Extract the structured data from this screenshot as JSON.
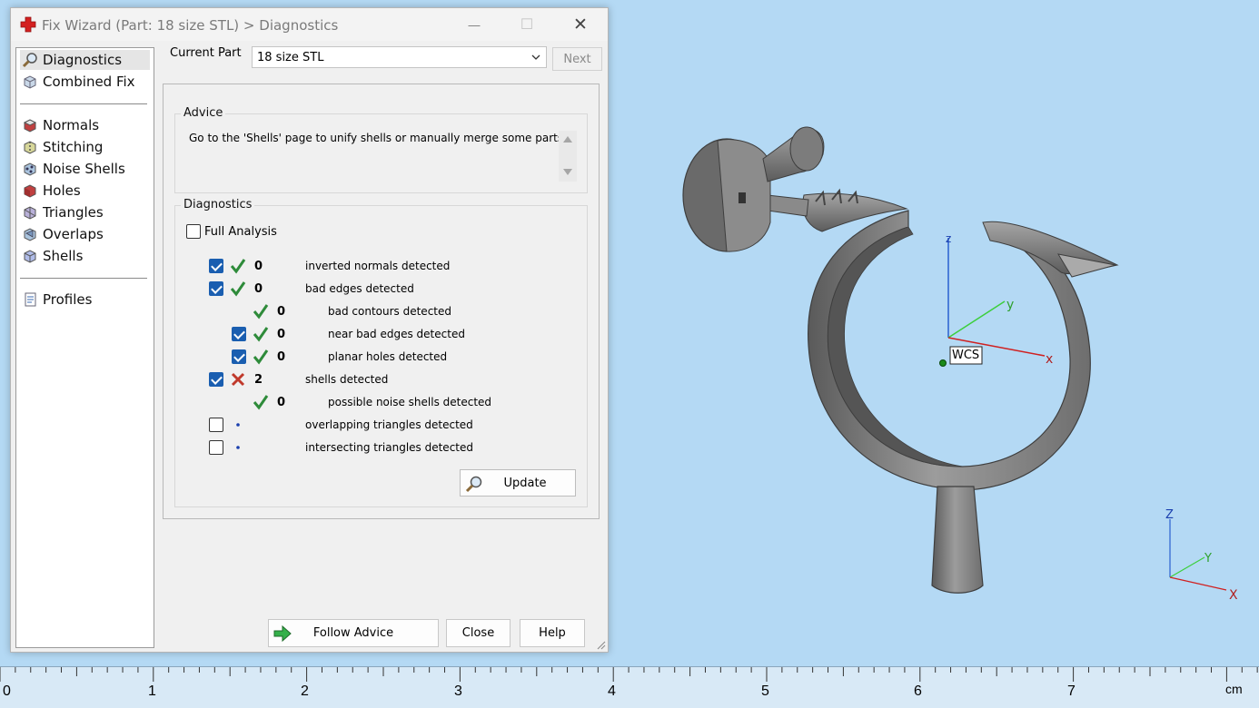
{
  "window": {
    "title": "Fix Wizard (Part: 18 size STL) > Diagnostics",
    "minimize": "—",
    "maximize": "☐",
    "close": "✕"
  },
  "nav": {
    "items": [
      {
        "label": "Diagnostics",
        "icon": "magnifier-icon",
        "selected": true
      },
      {
        "label": "Combined Fix",
        "icon": "combined-fix-icon"
      },
      {
        "label": "Normals",
        "icon": "normals-icon"
      },
      {
        "label": "Stitching",
        "icon": "stitching-icon"
      },
      {
        "label": "Noise Shells",
        "icon": "noise-shells-icon"
      },
      {
        "label": "Holes",
        "icon": "holes-icon"
      },
      {
        "label": "Triangles",
        "icon": "triangles-icon"
      },
      {
        "label": "Overlaps",
        "icon": "overlaps-icon"
      },
      {
        "label": "Shells",
        "icon": "shells-icon"
      },
      {
        "label": "Profiles",
        "icon": "profiles-icon"
      }
    ]
  },
  "current_part": {
    "label": "Current Part",
    "value": "18 size STL",
    "next_label": "Next"
  },
  "advice": {
    "title": "Advice",
    "text": "Go to the 'Shells' page to unify shells or manually merge some parts."
  },
  "diagnostics": {
    "title": "Diagnostics",
    "full_analysis": "Full Analysis",
    "rows": [
      {
        "checked": true,
        "status": "ok",
        "count": "0",
        "label": "inverted normals detected",
        "indent": 0
      },
      {
        "checked": true,
        "status": "ok",
        "count": "0",
        "label": "bad edges detected",
        "indent": 0
      },
      {
        "checked": null,
        "status": "ok",
        "count": "0",
        "label": "bad contours detected",
        "indent": 1
      },
      {
        "checked": true,
        "status": "ok",
        "count": "0",
        "label": "near bad edges detected",
        "indent": 1
      },
      {
        "checked": true,
        "status": "ok",
        "count": "0",
        "label": "planar holes detected",
        "indent": 1
      },
      {
        "checked": true,
        "status": "error",
        "count": "2",
        "label": "shells detected",
        "indent": 0
      },
      {
        "checked": null,
        "status": "ok",
        "count": "0",
        "label": "possible noise shells detected",
        "indent": 1
      },
      {
        "checked": false,
        "status": "pending",
        "count": "",
        "label": "overlapping triangles detected",
        "indent": 0
      },
      {
        "checked": false,
        "status": "pending",
        "count": "",
        "label": "intersecting triangles detected",
        "indent": 0
      }
    ],
    "update_label": "Update"
  },
  "buttons": {
    "follow_advice": "Follow Advice",
    "close": "Close",
    "help": "Help"
  },
  "viewport": {
    "wcs_label": "WCS",
    "axis_x": "x",
    "axis_y": "y",
    "axis_z": "z",
    "corner_x": "X",
    "corner_y": "Y",
    "corner_z": "Z",
    "background": "#b4d9f4"
  },
  "ruler": {
    "labels": [
      "0",
      "1",
      "2",
      "3",
      "4",
      "5",
      "6",
      "7"
    ],
    "unit": "cm"
  },
  "colors": {
    "check_blue": "#1a5eb0",
    "ok_green": "#2e8b3a",
    "error_red": "#c0392b",
    "pending_blue": "#1a3fae"
  }
}
